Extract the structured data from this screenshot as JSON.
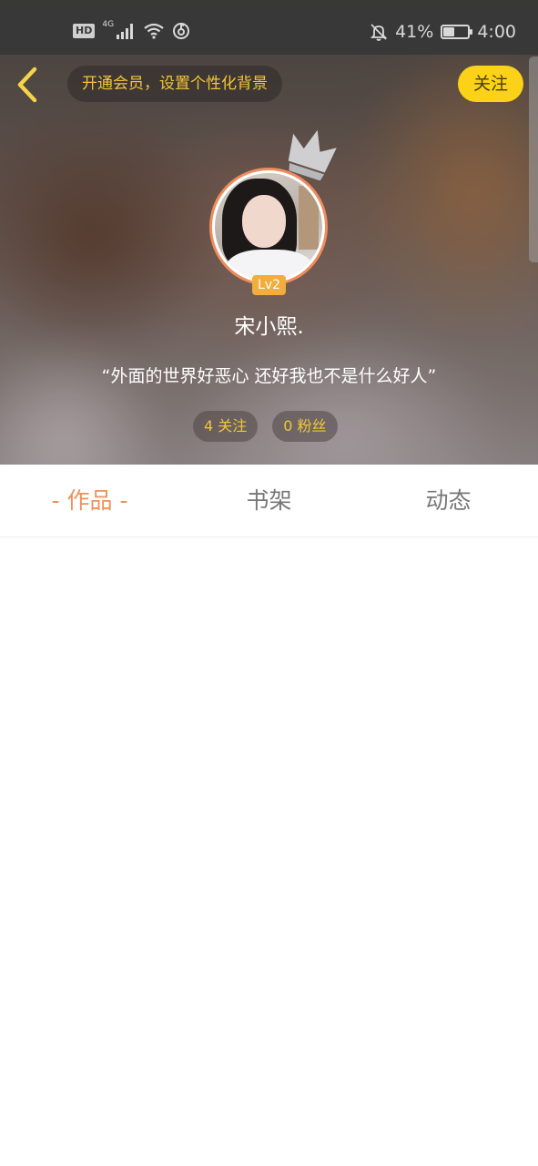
{
  "status_bar": {
    "hd_label": "HD",
    "network_label": "4G",
    "battery_percent": "41%",
    "battery_level": 0.41,
    "time": "4:00"
  },
  "header": {
    "vip_prompt": "开通会员，设置个性化背景",
    "follow_label": "关注"
  },
  "profile": {
    "level": "Lv2",
    "username": "宋小熙.",
    "motto": "“外面的世界好恶心 还好我也不是什么好人”",
    "following": "4 关注",
    "followers": "0 粉丝"
  },
  "colors": {
    "accent_orange": "#ee9159",
    "brand_yellow": "#fbd217",
    "gold_text": "#f3c636"
  },
  "tabs": [
    {
      "label": "作品",
      "active": true
    },
    {
      "label": "书架",
      "active": false
    },
    {
      "label": "动态",
      "active": false
    }
  ]
}
